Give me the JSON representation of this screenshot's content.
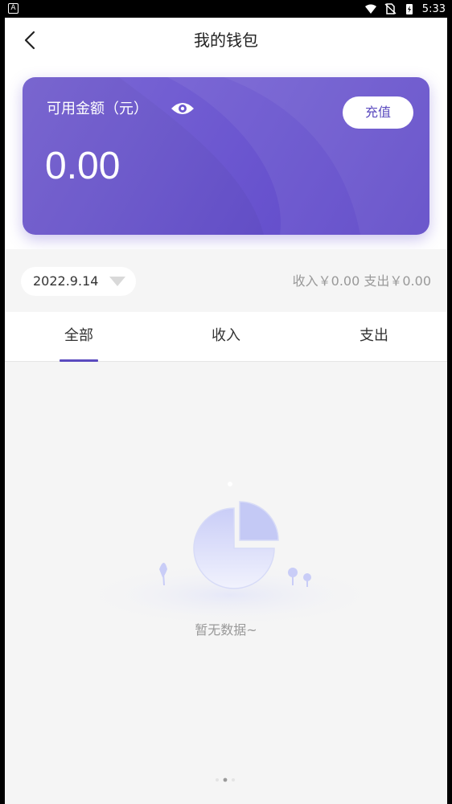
{
  "status_bar": {
    "left_badge": "A",
    "time": "5:33"
  },
  "header": {
    "title": "我的钱包"
  },
  "wallet": {
    "balance_label": "可用金额（元）",
    "balance": "0.00",
    "recharge_label": "充值"
  },
  "filter": {
    "date": "2022.9.14",
    "summary": "收入￥0.00 支出￥0.00"
  },
  "tabs": [
    {
      "label": "全部",
      "active": true
    },
    {
      "label": "收入",
      "active": false
    },
    {
      "label": "支出",
      "active": false
    }
  ],
  "empty_state": {
    "message": "暂无数据~"
  },
  "colors": {
    "accent": "#5b4bbf",
    "card_start": "#7d6ad6",
    "card_end": "#5b45c6",
    "muted_text": "#999999"
  }
}
